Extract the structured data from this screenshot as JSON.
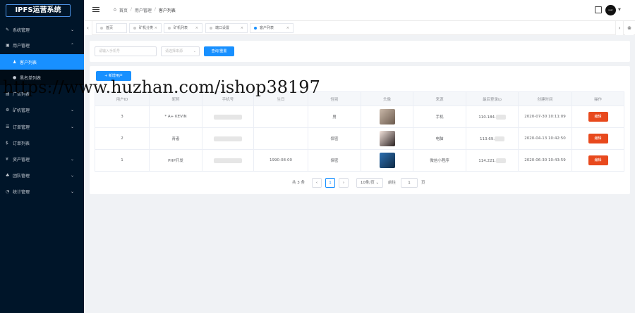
{
  "app": {
    "title": "IPFS运营系统"
  },
  "sidebar": {
    "items": [
      {
        "label": "系统管理",
        "icon": "wrench-icon"
      },
      {
        "label": "用户管理",
        "icon": "user-icon",
        "expanded": true,
        "children": [
          {
            "label": "客户列表",
            "active": true
          },
          {
            "label": "黑名单列表"
          }
        ]
      },
      {
        "label": "广告列表",
        "icon": "ad-icon"
      },
      {
        "label": "矿机管理",
        "icon": "server-icon"
      },
      {
        "label": "订单管理",
        "icon": "list-icon"
      },
      {
        "label": "订单列表",
        "icon": "order-icon"
      },
      {
        "label": "资产管理",
        "icon": "yen-icon"
      },
      {
        "label": "团队管理",
        "icon": "team-icon"
      },
      {
        "label": "统计管理",
        "icon": "chart-icon"
      }
    ]
  },
  "breadcrumb": {
    "home": "首页",
    "parent": "用户管理",
    "current": "客户列表"
  },
  "tabs": [
    {
      "label": "首页"
    },
    {
      "label": "矿机分类"
    },
    {
      "label": "矿机列表"
    },
    {
      "label": "端口设置"
    },
    {
      "label": "客户列表",
      "active": true
    }
  ],
  "search": {
    "phone_placeholder": "请输入手机号",
    "source_placeholder": "请选择来源",
    "query_label": "查询/重置"
  },
  "add_user_label": "+ 新增用户",
  "table": {
    "headers": [
      "用户ID",
      "昵称",
      "手机号",
      "生日",
      "性别",
      "头像",
      "来源",
      "最后登录ip",
      "创建时间",
      "操作"
    ],
    "rows": [
      {
        "id": "3",
        "nickname": "* A+ KEVIN",
        "birthday": "",
        "gender": "男",
        "source": "手机",
        "ip": "110.184.",
        "created": "2020-07-30 10:11:09",
        "action": "编辑"
      },
      {
        "id": "2",
        "nickname": "青者",
        "birthday": "",
        "gender": "保密",
        "source": "电脑",
        "ip": "113.69.",
        "created": "2020-04-13 10:42:50",
        "action": "编辑"
      },
      {
        "id": "1",
        "nickname": "PHP开发",
        "birthday": "1990-08-00",
        "gender": "保密",
        "source": "微信小程序",
        "ip": "114.221.",
        "created": "2020-06-30 10:43:59",
        "action": "编辑"
      }
    ]
  },
  "pagination": {
    "total": "共 3 条",
    "current_page": "1",
    "page_size": "10条/页",
    "goto": "前往",
    "goto_value": "1",
    "page_suffix": "页"
  },
  "watermark": "https://www.huzhan.com/ishop38197",
  "avatar_text": "user",
  "colors": {
    "sidebar": "#001529",
    "primary": "#1890ff",
    "danger": "#e8491d"
  }
}
